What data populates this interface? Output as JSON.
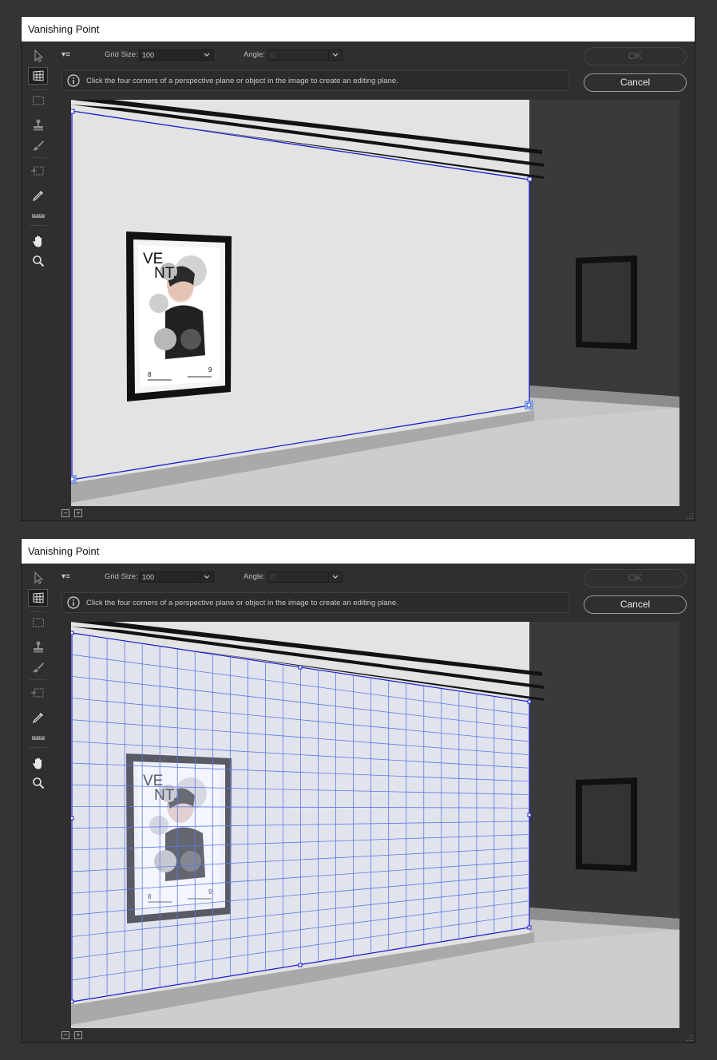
{
  "dialogs": [
    {
      "title": "Vanishing Point",
      "options": {
        "menu_glyph": "▾≡",
        "grid_size_label": "Grid Size:",
        "grid_size_value": "100",
        "angle_label": "Angle:",
        "angle_value": "0"
      },
      "info_message": "Click the four corners of a perspective plane or object in the image to create an editing plane.",
      "ok_label": "OK",
      "cancel_label": "Cancel",
      "bottom_minus": "−",
      "bottom_plus": "+",
      "plane_state": "outline"
    },
    {
      "title": "Vanishing Point",
      "options": {
        "menu_glyph": "▾≡",
        "grid_size_label": "Grid Size:",
        "grid_size_value": "100",
        "angle_label": "Angle:",
        "angle_value": "0"
      },
      "info_message": "Click the four corners of a perspective plane or object in the image to create an editing plane.",
      "ok_label": "OK",
      "cancel_label": "Cancel",
      "bottom_minus": "−",
      "bottom_plus": "+",
      "plane_state": "grid"
    }
  ],
  "tools": [
    "edit-plane-icon",
    "create-plane-icon",
    "marquee-icon",
    "stamp-icon",
    "brush-icon",
    "transform-icon",
    "eyedropper-icon",
    "measure-icon",
    "hand-icon",
    "zoom-icon"
  ],
  "poster": {
    "headline_top": "VE",
    "headline_bottom": "NT.",
    "left_number": "8",
    "right_number": "9"
  },
  "colors": {
    "plane_edge": "#1a1ad0",
    "grid_line": "#5b78e6",
    "dialog_bg": "#2f2f2f"
  }
}
